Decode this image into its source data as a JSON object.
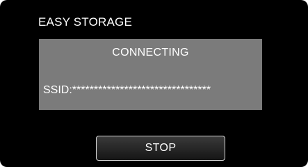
{
  "header": {
    "title": "EASY STORAGE"
  },
  "status_panel": {
    "heading": "CONNECTING",
    "ssid_label": "SSID:",
    "ssid_value": "********************************"
  },
  "actions": {
    "stop_label": "STOP"
  },
  "colors": {
    "screen_background": "#000000",
    "panel_background": "#7b7b7b",
    "text": "#ffffff",
    "button_border": "#d8d8d8"
  }
}
